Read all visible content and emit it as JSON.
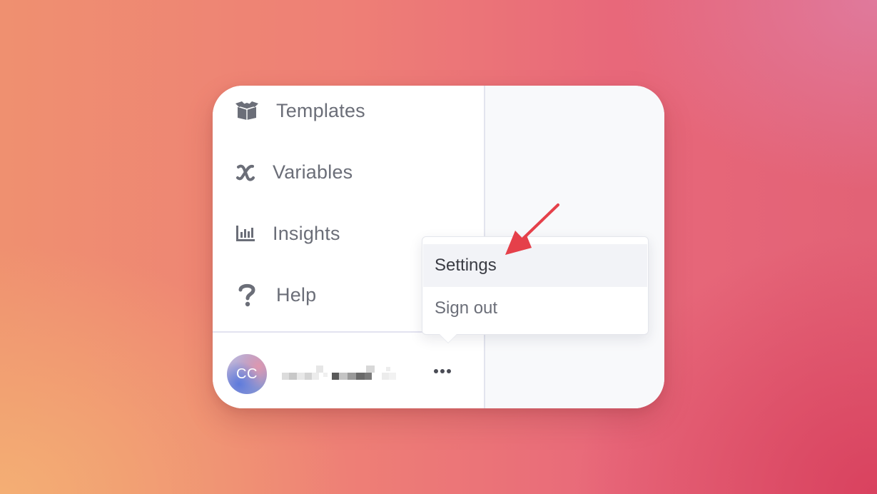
{
  "sidebar": {
    "items": [
      {
        "label": "Templates",
        "icon": "box-icon"
      },
      {
        "label": "Variables",
        "icon": "variable-x-icon"
      },
      {
        "label": "Insights",
        "icon": "bar-chart-icon"
      },
      {
        "label": "Help",
        "icon": "question-icon"
      }
    ]
  },
  "profile": {
    "avatar_initials": "CC",
    "more_icon": "ellipsis-icon"
  },
  "menu": {
    "items": [
      {
        "label": "Settings",
        "state": "highlighted"
      },
      {
        "label": "Sign out",
        "state": "normal"
      }
    ]
  },
  "colors": {
    "nav_text": "#6b6e78",
    "menu_highlight": "#f2f3f7",
    "annotation_arrow": "#e5404a"
  }
}
